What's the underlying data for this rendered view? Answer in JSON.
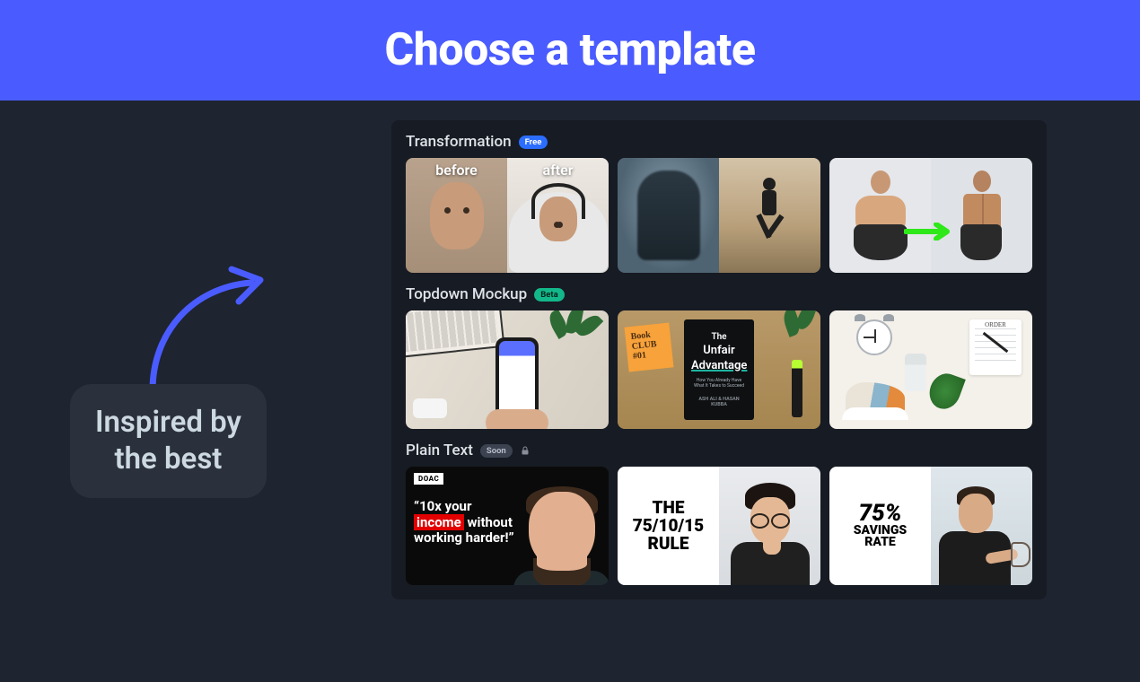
{
  "header": {
    "title": "Choose a template"
  },
  "callout": {
    "line1": "Inspired by",
    "line2": "the best"
  },
  "sections": [
    {
      "title": "Transformation",
      "badge": {
        "label": "Free",
        "kind": "free"
      },
      "thumbs": [
        {
          "label_left": "before",
          "label_right": "after"
        },
        {},
        {}
      ]
    },
    {
      "title": "Topdown Mockup",
      "badge": {
        "label": "Beta",
        "kind": "beta"
      },
      "thumbs": [
        {},
        {
          "sticky_text": "Book CLUB #01",
          "book_the": "The",
          "book_unfair": "Unfair",
          "book_adv": "Advantage",
          "book_sub": "How You Already Have What It Takes to Succeed",
          "book_auth": "ASH ALI & HASAN KUBBA"
        },
        {
          "notepad_title": "ORDER"
        }
      ]
    },
    {
      "title": "Plain Text",
      "badge": {
        "label": "Soon",
        "kind": "soon"
      },
      "locked": true,
      "thumbs": [
        {
          "tag": "DOAC",
          "quote_open": "“",
          "t1": "10x your",
          "t2_red": "income",
          "t2_rest": " without",
          "t3": "working harder!”"
        },
        {
          "l1": "THE",
          "l2": "75/10/15",
          "l3": "RULE"
        },
        {
          "big": "75%",
          "s1": "SAVINGS",
          "s2": "RATE"
        }
      ]
    }
  ]
}
